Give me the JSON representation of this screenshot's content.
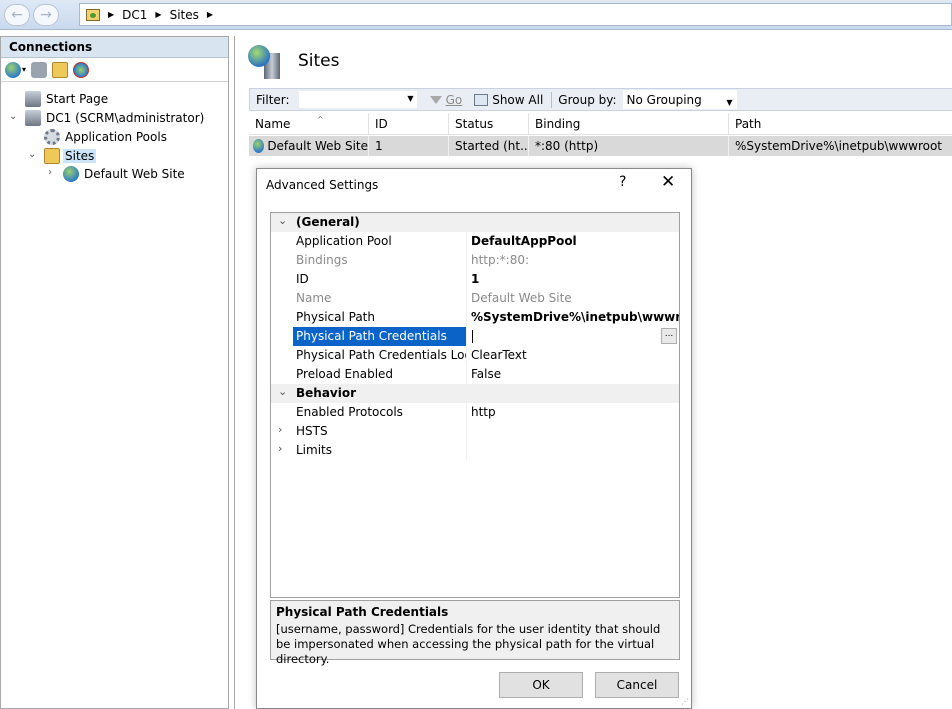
{
  "address": {
    "segments": [
      "DC1",
      "Sites"
    ]
  },
  "connections": {
    "header": "Connections",
    "tree": {
      "start_page": "Start Page",
      "server": "DC1 (SCRM\\administrator)",
      "app_pools": "Application Pools",
      "sites": "Sites",
      "default_site": "Default Web Site"
    }
  },
  "main": {
    "title": "Sites",
    "filter": {
      "label": "Filter:",
      "go": "Go",
      "show_all": "Show All",
      "group_by_label": "Group by:",
      "group_by_value": "No Grouping"
    },
    "columns": [
      "Name",
      "ID",
      "Status",
      "Binding",
      "Path"
    ],
    "rows": [
      {
        "name": "Default Web Site",
        "id": "1",
        "status": "Started (ht...",
        "binding": "*:80 (http)",
        "path": "%SystemDrive%\\inetpub\\wwwroot"
      }
    ]
  },
  "dialog": {
    "title": "Advanced Settings",
    "help": "?",
    "close": "✕",
    "categories": {
      "general": "(General)",
      "behavior": "Behavior"
    },
    "properties": [
      {
        "name": "Application Pool",
        "value": "DefaultAppPool"
      },
      {
        "name": "Bindings",
        "value": "http:*:80:"
      },
      {
        "name": "ID",
        "value": "1"
      },
      {
        "name": "Name",
        "value": "Default Web Site"
      },
      {
        "name": "Physical Path",
        "value": "%SystemDrive%\\inetpub\\wwwroot"
      },
      {
        "name": "Physical Path Credentials",
        "value": ""
      },
      {
        "name": "Physical Path Credentials Logon",
        "value": "ClearText"
      },
      {
        "name": "Preload Enabled",
        "value": "False"
      },
      {
        "name": "Enabled Protocols",
        "value": "http"
      },
      {
        "name": "HSTS",
        "value": ""
      },
      {
        "name": "Limits",
        "value": ""
      }
    ],
    "ellipsis": "...",
    "description": {
      "title": "Physical Path Credentials",
      "text": "[username, password] Credentials for the user identity that should be impersonated when accessing the physical path for the virtual directory."
    },
    "ok": "OK",
    "cancel": "Cancel"
  }
}
